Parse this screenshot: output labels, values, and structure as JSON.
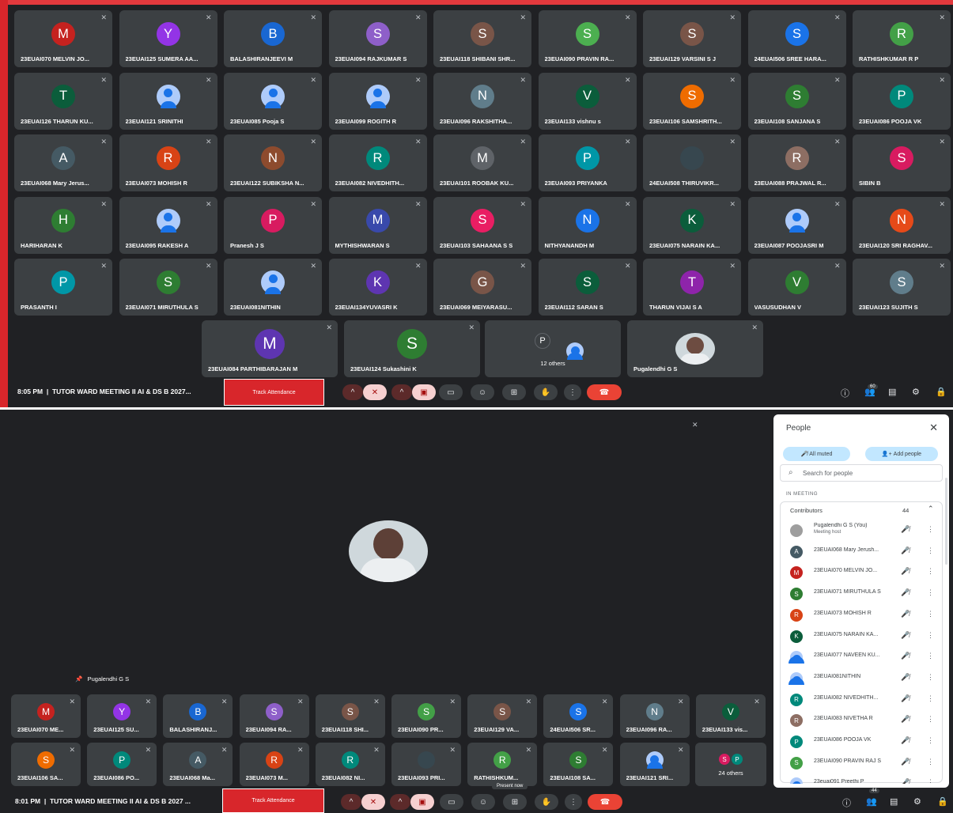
{
  "top": {
    "grid": [
      [
        [
          "M",
          "23EUAI070 MELVIN JO...",
          "#c5221f"
        ],
        [
          "Y",
          "23EUAI125 SUMERA AA...",
          "#9334e6"
        ],
        [
          "B",
          "BALASHIRANJEEVI M",
          "#1967d2"
        ],
        [
          "S",
          "23EUAI094 RAJKUMAR S",
          "#8e5fc9"
        ],
        [
          "S",
          "23EUAI118 SHIBANI SHR...",
          "#795548"
        ],
        [
          "S",
          "23EUAI090 PRAVIN RA...",
          "#4caf50"
        ],
        [
          "S",
          "23EUAI129 VARSINI S J",
          "#795548"
        ],
        [
          "S",
          "24EUAI506 SREE HARA...",
          "#1a73e8"
        ],
        [
          "R",
          "RATHISHKUMAR R P",
          "#43a047"
        ]
      ],
      [
        [
          "T",
          "23EUAI126 THARUN KU...",
          "#0b5d3b"
        ],
        [
          "",
          "23EUAI121 SRINITHI",
          "p"
        ],
        [
          "",
          "23EUAI085 Pooja S",
          "p"
        ],
        [
          "",
          "23EUAI099 ROGITH R",
          "p"
        ],
        [
          "N",
          "23EUAI096 RAKSHITHA...",
          "#607d8b"
        ],
        [
          "V",
          "23EUAI133 vishnu s",
          "#0b5d3b"
        ],
        [
          "S",
          "23EUAI106 SAMSHRITH...",
          "#ef6c00"
        ],
        [
          "S",
          "23EUAI108 SANJANA S",
          "#2e7d32"
        ],
        [
          "P",
          "23EUAI086 POOJA VK",
          "#00897b"
        ]
      ],
      [
        [
          "A",
          "23EUAI068 Mary Jerus...",
          "#455a64"
        ],
        [
          "R",
          "23EUAI073 MOHISH R",
          "#d84315"
        ],
        [
          "N",
          "23EUAI122 SUBIKSHA N...",
          "#8d4b2e"
        ],
        [
          "R",
          "23EUAI082 NIVEDHITH...",
          "#00897b"
        ],
        [
          "M",
          "23EUAI101 ROOBAK KU...",
          "#5f6368"
        ],
        [
          "P",
          "23EUAI093 PRIYANKA",
          "#0097a7"
        ],
        [
          "",
          "24EUAI508 THIRUVIKR...",
          "#37474f"
        ],
        [
          "R",
          "23EUAI088 PRAJWAL R...",
          "#8d6e63"
        ],
        [
          "S",
          "SIBIN B",
          "#d81b60"
        ]
      ],
      [
        [
          "H",
          "HARIHARAN K",
          "#2e7d32"
        ],
        [
          "",
          "23EUAI095 RAKESH A",
          "p"
        ],
        [
          "P",
          "Pranesh J S",
          "#d81b60"
        ],
        [
          "M",
          "MYTHISHWARAN S",
          "#3949ab"
        ],
        [
          "S",
          "23EUAI103 SAHAANA S S",
          "#e91e63"
        ],
        [
          "N",
          "NITHYANANDH M",
          "#1a73e8"
        ],
        [
          "K",
          "23EUAI075 NARAIN KA...",
          "#0b5d3b"
        ],
        [
          "",
          "23EUAI087 POOJASRI M",
          "p"
        ],
        [
          "N",
          "23EUAI120 SRI RAGHAV...",
          "#e64a19"
        ]
      ],
      [
        [
          "P",
          "PRASANTH I",
          "#0097a7"
        ],
        [
          "S",
          "23EUAI071 MIRUTHULA S",
          "#2e7d32"
        ],
        [
          "",
          "23EUAI081NITHIN",
          "p"
        ],
        [
          "K",
          "23EUAI134YUVASRI K",
          "#5e35b1"
        ],
        [
          "G",
          "23EUAI069 MEIYARASU...",
          "#795548"
        ],
        [
          "S",
          "23EUAI112 SARAN S",
          "#0b5d3b"
        ],
        [
          "T",
          "THARUN VIJAI S A",
          "#8e24aa"
        ],
        [
          "V",
          "VASUSUDHAN V",
          "#2e7d32"
        ],
        [
          "S",
          "23EUAI123 SUJITH S",
          "#607d8b"
        ]
      ]
    ],
    "bottom_row": [
      [
        "M",
        "23EUAI084 PARTHIBARAJAN M",
        "#5e35b1"
      ],
      [
        "S",
        "23EUAI124 Sukashini K",
        "#2e7d32"
      ]
    ],
    "others": "12 others",
    "host": "Pugalendhi G S",
    "time": "8:05 PM",
    "meeting": "TUTOR WARD MEETING II AI & DS B 2027...",
    "track": "Track Attendance",
    "people_count": "60"
  },
  "bottom": {
    "pinned": "Pugalendhi G S",
    "row1": [
      [
        "M",
        "23EUAI070 ME...",
        "#c5221f"
      ],
      [
        "Y",
        "23EUAI125 SU...",
        "#9334e6"
      ],
      [
        "B",
        "BALASHIRANJ...",
        "#1967d2"
      ],
      [
        "S",
        "23EUAI094 RA...",
        "#8e5fc9"
      ],
      [
        "S",
        "23EUAI118 SHI...",
        "#795548"
      ],
      [
        "S",
        "23EUAI090 PR...",
        "#43a047"
      ],
      [
        "S",
        "23EUAI129 VA...",
        "#795548"
      ],
      [
        "S",
        "24EUAI506 SR...",
        "#1a73e8"
      ],
      [
        "N",
        "23EUAI096 RA...",
        "#607d8b"
      ],
      [
        "V",
        "23EUAI133 vis...",
        "#0b5d3b"
      ]
    ],
    "row2": [
      [
        "S",
        "23EUAI106 SA...",
        "#ef6c00"
      ],
      [
        "P",
        "23EUAI086 PO...",
        "#00897b"
      ],
      [
        "A",
        "23EUAI068 Ma...",
        "#455a64"
      ],
      [
        "R",
        "23EUAI073 M...",
        "#d84315"
      ],
      [
        "R",
        "23EUAI082 NI...",
        "#00897b"
      ],
      [
        "",
        "23EUAI093 PRI...",
        "#37474f"
      ],
      [
        "R",
        "RATHISHKUM...",
        "#43a047"
      ],
      [
        "S",
        "23EUAI108 SA...",
        "#2e7d32"
      ],
      [
        "",
        "23EUAI121 SRI...",
        "p"
      ]
    ],
    "others": "24 others",
    "present_now": "Present now",
    "time": "8:01 PM",
    "meeting": "TUTOR WARD MEETING II AI & DS B 2027 ...",
    "track": "Track Attendance",
    "people_count": "44"
  },
  "panel": {
    "title": "People",
    "all_muted": "All muted",
    "add_people": "Add people",
    "search_placeholder": "Search for people",
    "in_meeting": "IN MEETING",
    "contributors": "Contributors",
    "count": "44",
    "people": [
      [
        "",
        "Pugalendhi G S (You)",
        "#9e9e9e",
        "Meeting host"
      ],
      [
        "A",
        "23EUAI068 Mary Jerush...",
        "#455a64",
        ""
      ],
      [
        "M",
        "23EUAI070 MELVIN JO...",
        "#c5221f",
        ""
      ],
      [
        "S",
        "23EUAI071 MIRUTHULA S",
        "#2e7d32",
        ""
      ],
      [
        "R",
        "23EUAI073 MOHISH R",
        "#d84315",
        ""
      ],
      [
        "K",
        "23EUAI075 NARAIN KA...",
        "#0b5d3b",
        ""
      ],
      [
        "",
        "23EUAI077 NAVEEN KU...",
        "p",
        ""
      ],
      [
        "",
        "23EUAI081NITHIN",
        "p",
        ""
      ],
      [
        "R",
        "23EUAI082 NIVEDHITH...",
        "#00897b",
        ""
      ],
      [
        "R",
        "23EUAI083 NIVETHA R",
        "#8d6e63",
        ""
      ],
      [
        "P",
        "23EUAI086 POOJA VK",
        "#00897b",
        ""
      ],
      [
        "S",
        "23EUAI090 PRAVIN RAJ S",
        "#43a047",
        ""
      ],
      [
        "",
        "23euai091 Preethi P",
        "p",
        ""
      ]
    ]
  }
}
